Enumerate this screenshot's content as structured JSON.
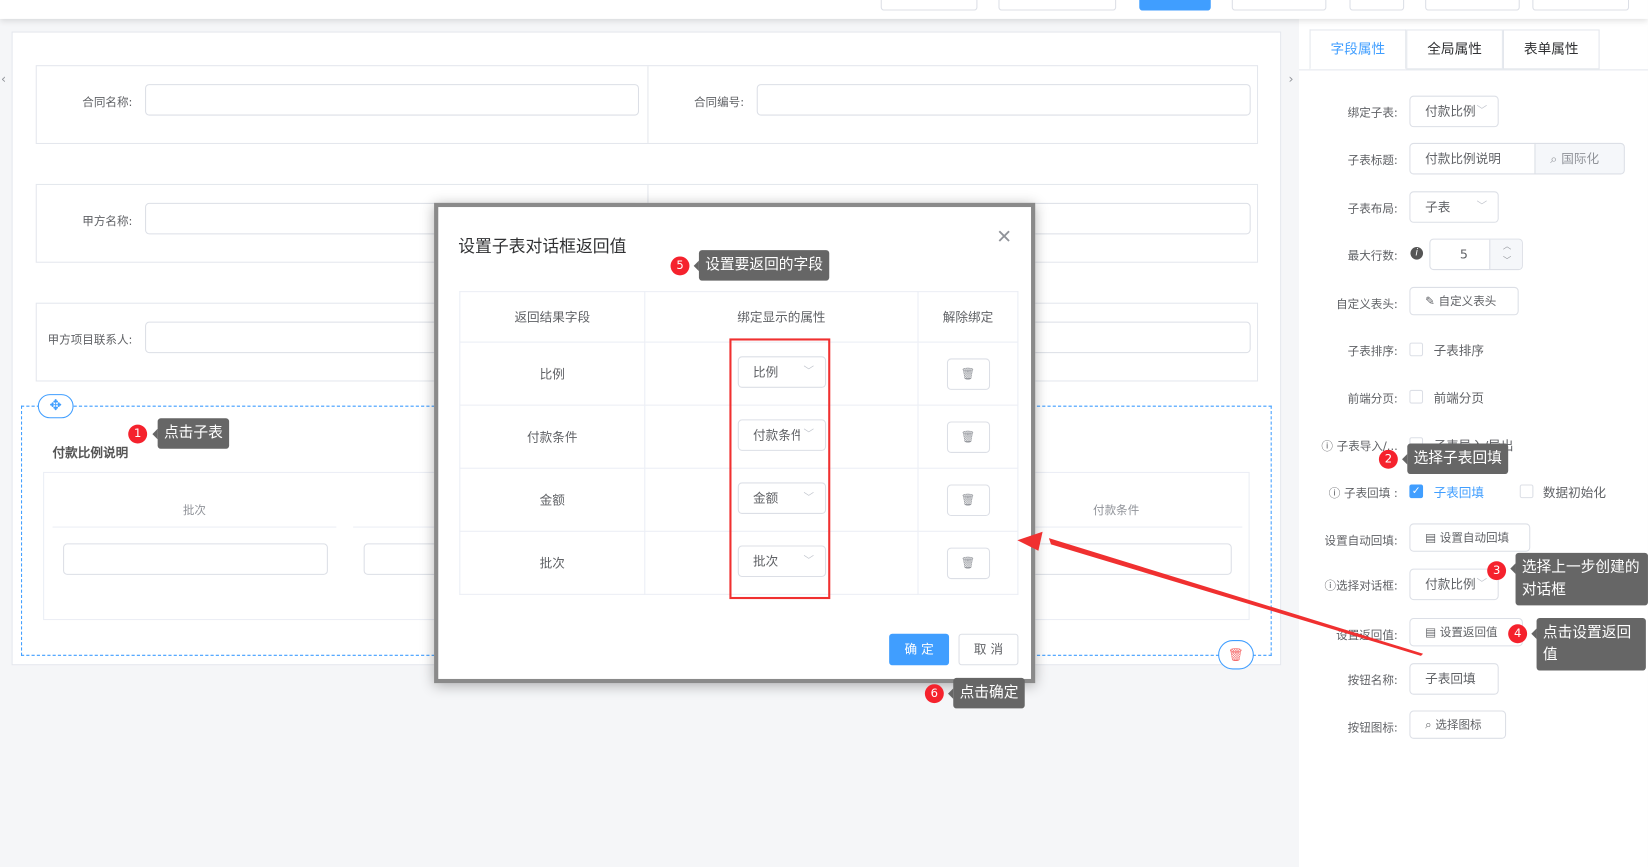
{
  "form": {
    "contract_name_label": "合同名称:",
    "contract_no_label": "合同编号:",
    "party_a_label": "甲方名称:",
    "party_a_contact_label": "甲方项目联系人:",
    "subtable_title": "付款比例说明",
    "subtable_columns": [
      "批次",
      "付款条件"
    ]
  },
  "right_panel": {
    "tabs": [
      "字段属性",
      "全局属性",
      "表单属性"
    ],
    "bind_subtable_label": "绑定子表:",
    "bind_subtable_value": "付款比例",
    "subtable_title_label": "子表标题:",
    "subtable_title_value": "付款比例说明",
    "i18n_button": "国际化",
    "layout_label": "子表布局:",
    "layout_value": "子表",
    "max_rows_label": "最大行数:",
    "max_rows_value": "5",
    "custom_header_label": "自定义表头:",
    "custom_header_button": "自定义表头",
    "sort_label": "子表排序:",
    "sort_option": "子表排序",
    "paging_label": "前端分页:",
    "paging_option": "前端分页",
    "import_label": "子表导入/...",
    "import_option": "子表导入/导出",
    "backfill_label": "子表回填 :",
    "backfill_option": "子表回填",
    "data_init_option": "数据初始化",
    "auto_backfill_label": "设置自动回填:",
    "auto_backfill_button": "设置自动回填",
    "dialog_label": "选择对话框:",
    "dialog_value": "付款比例",
    "return_label": "设置返回值:",
    "return_button": "设置返回值",
    "btn_name_label": "按钮名称:",
    "btn_name_value": "子表回填",
    "btn_icon_label": "按钮图标:",
    "btn_icon_button": "选择图标"
  },
  "dialog": {
    "title": "设置子表对话框返回值",
    "headers": [
      "返回结果字段",
      "绑定显示的属性",
      "解除绑定"
    ],
    "rows": [
      {
        "field": "比例",
        "bound": "比例"
      },
      {
        "field": "付款条件",
        "bound": "付款条件"
      },
      {
        "field": "金额",
        "bound": "金额"
      },
      {
        "field": "批次",
        "bound": "批次"
      }
    ],
    "confirm": "确 定",
    "cancel": "取 消"
  },
  "annotations": [
    {
      "n": "1",
      "text": "点击子表"
    },
    {
      "n": "2",
      "text": "选择子表回填"
    },
    {
      "n": "3",
      "text": "选择上一步创建的对话框"
    },
    {
      "n": "4",
      "text": "点击设置返回值"
    },
    {
      "n": "5",
      "text": "设置要返回的字段"
    },
    {
      "n": "6",
      "text": "点击确定"
    }
  ],
  "colors": {
    "primary": "#409eff",
    "annotation_red": "#f5222d",
    "tooltip": "#666666"
  }
}
